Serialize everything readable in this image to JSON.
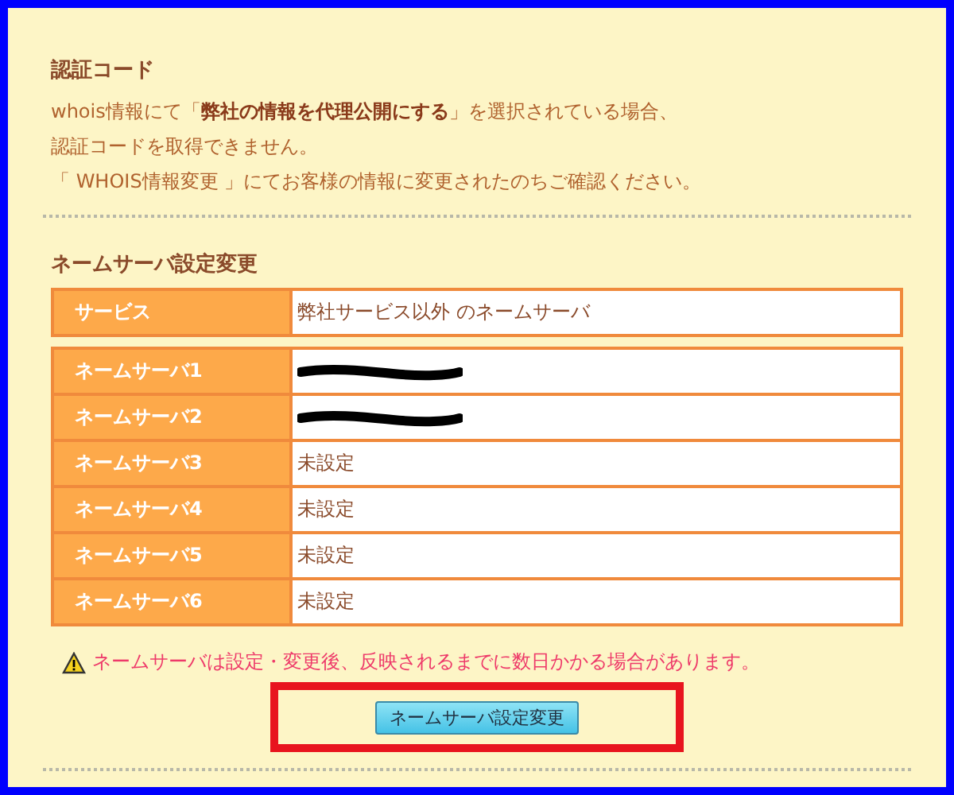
{
  "auth_code": {
    "heading": "認証コード",
    "lines": [
      "whois情報にて「**弊社の情報を代理公開にする**」を選択されている場合、",
      "認証コードを取得できません。",
      "「 WHOIS情報変更 」にてお客様の情報に変更されたのちご確認ください。"
    ]
  },
  "nameserver": {
    "heading": "ネームサーバ設定変更",
    "service": {
      "label": "サービス",
      "value": "弊社サービス以外 のネームサーバ"
    },
    "servers": [
      {
        "label": "ネームサーバ1",
        "kind": "redacted"
      },
      {
        "label": "ネームサーバ2",
        "kind": "redacted"
      },
      {
        "label": "ネームサーバ3",
        "kind": "text",
        "value": "未設定"
      },
      {
        "label": "ネームサーバ4",
        "kind": "text",
        "value": "未設定"
      },
      {
        "label": "ネームサーバ5",
        "kind": "text",
        "value": "未設定"
      },
      {
        "label": "ネームサーバ6",
        "kind": "text",
        "value": "未設定"
      }
    ],
    "warning": "ネームサーバは設定・変更後、反映されるまでに数日かかる場合があります。",
    "button": "ネームサーバ設定変更"
  }
}
